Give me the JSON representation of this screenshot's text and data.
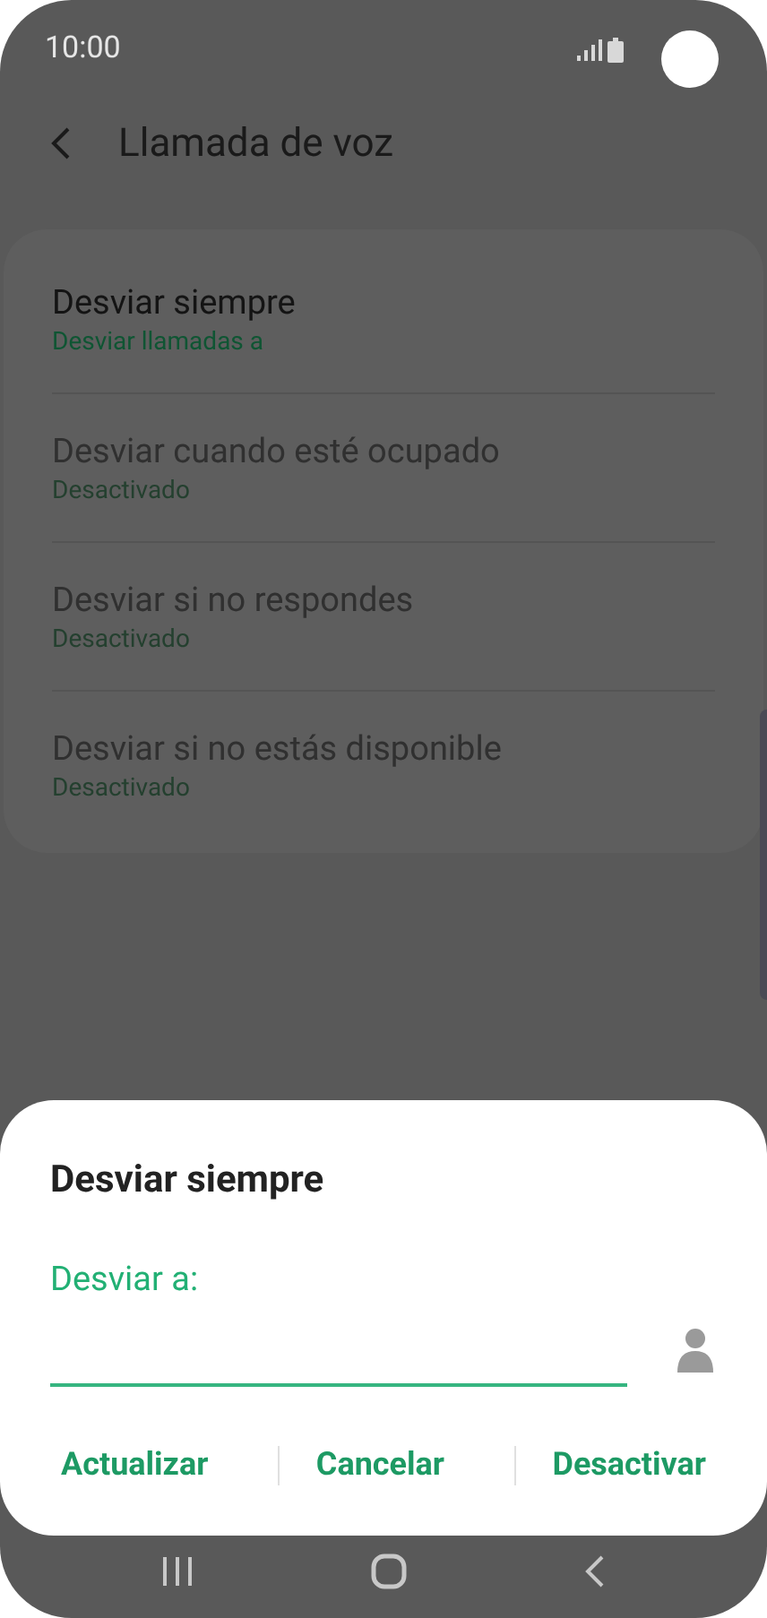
{
  "status_bar": {
    "time": "10:00"
  },
  "header": {
    "title": "Llamada de voz"
  },
  "settings": [
    {
      "title": "Desviar siempre",
      "subtitle": "Desviar llamadas a",
      "disabled": false
    },
    {
      "title": "Desviar cuando esté ocupado",
      "subtitle": "Desactivado",
      "disabled": true
    },
    {
      "title": "Desviar si no respondes",
      "subtitle": "Desactivado",
      "disabled": true
    },
    {
      "title": "Desviar si no estás disponible",
      "subtitle": "Desactivado",
      "disabled": true
    }
  ],
  "dialog": {
    "title": "Desviar siempre",
    "field_label": "Desviar a:",
    "buttons": [
      "Actualizar",
      "Cancelar",
      "Desactivar"
    ]
  }
}
